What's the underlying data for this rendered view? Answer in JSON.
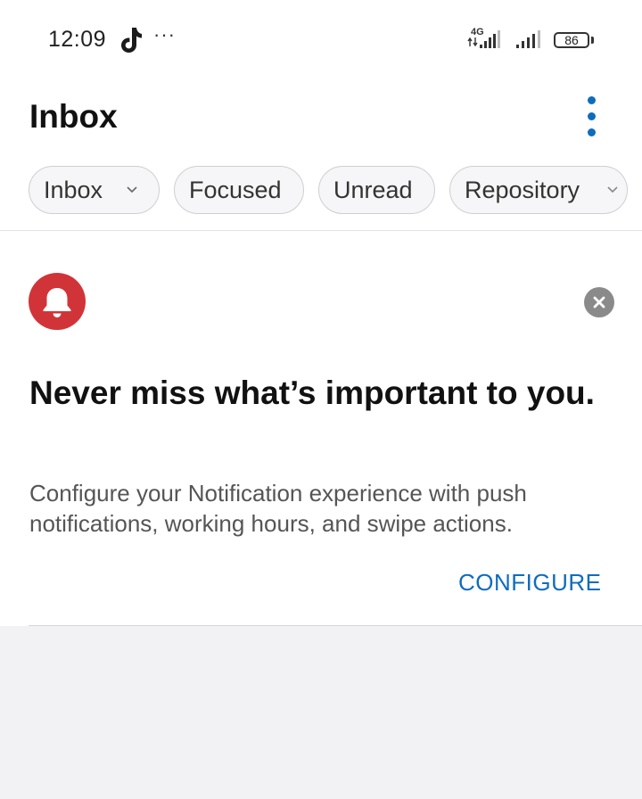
{
  "status_bar": {
    "time": "12:09",
    "more": "···",
    "network": "4G",
    "battery": "86",
    "icons": [
      "tiktok-icon",
      "signal-icon",
      "battery-icon"
    ]
  },
  "header": {
    "title": "Inbox",
    "menu_icon": "more-vertical-icon"
  },
  "filters": [
    {
      "label": "Inbox",
      "has_dropdown": true
    },
    {
      "label": "Focused",
      "has_dropdown": false
    },
    {
      "label": "Unread",
      "has_dropdown": false
    },
    {
      "label": "Repository",
      "has_dropdown": true
    }
  ],
  "notification_card": {
    "icon": "bell-icon",
    "heading": "Never miss what’s important to you.",
    "body": "Configure your Notification experience with push notifications, working hours, and swipe actions.",
    "action_label": "CONFIGURE",
    "dismiss_icon": "close-icon"
  },
  "colors": {
    "accent": "#0f6cbd",
    "bell_badge": "#d13438",
    "background": "#f2f2f4"
  }
}
